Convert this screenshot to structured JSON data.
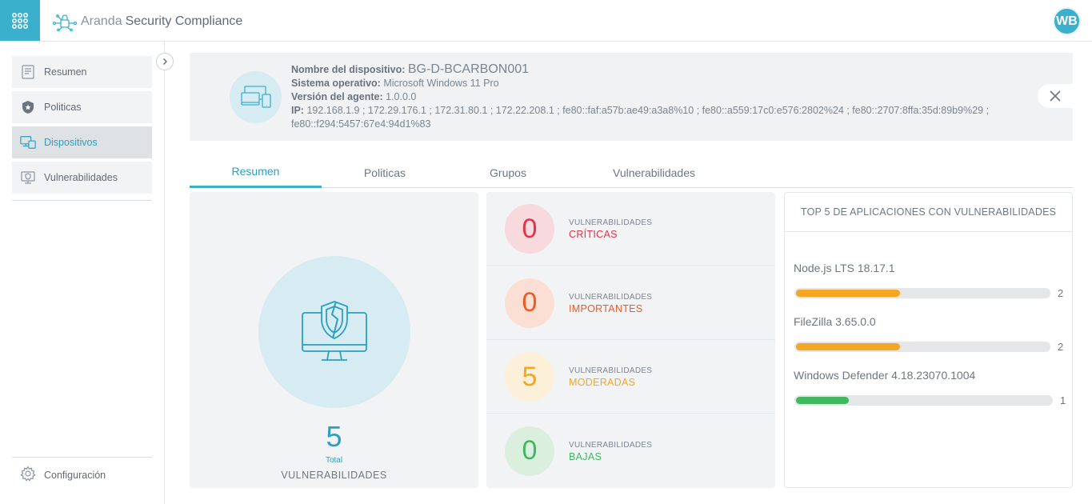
{
  "header": {
    "brand_aranda": "Aranda",
    "brand_product": "Security Compliance",
    "avatar_initials": "WB"
  },
  "sidebar": {
    "items": [
      {
        "label": "Resumen",
        "icon": "document-icon"
      },
      {
        "label": "Politicas",
        "icon": "shield-star-icon"
      },
      {
        "label": "Dispositivos",
        "icon": "devices-icon",
        "active": true
      },
      {
        "label": "Vulnerabilidades",
        "icon": "monitor-shield-icon"
      }
    ],
    "config_label": "Configuración"
  },
  "device": {
    "name_label": "Nombre del dispositivo:",
    "name_value": "BG-D-BCARBON001",
    "os_label": "Sistema operativo:",
    "os_value": "Microsoft Windows 11 Pro",
    "agent_label": "Versión del agente:",
    "agent_value": "1.0.0.0",
    "ip_label": "IP:",
    "ip_value": "192.168.1.9 ; 172.29.176.1 ; 172.31.80.1 ; 172.22.208.1 ; fe80::faf:a57b:ae49:a3a8%10 ; fe80::a559:17c0:e576:2802%24 ; fe80::2707:8ffa:35d:89b9%29 ; fe80::f294:5457:67e4:94d1%83"
  },
  "tabs": [
    {
      "label": "Resumen",
      "active": true
    },
    {
      "label": "Politicas"
    },
    {
      "label": "Grupos"
    },
    {
      "label": "Vulnerabilidades"
    }
  ],
  "summary": {
    "total_number": "5",
    "total_label": "Total",
    "vuln_label": "VULNERABILIDADES"
  },
  "severity": [
    {
      "count": "0",
      "small": "VULNERABILIDADES",
      "level": "CRÍTICAS",
      "color": "#e0344b",
      "bg": "#f8d9dd"
    },
    {
      "count": "0",
      "small": "VULNERABILIDADES",
      "level": "IMPORTANTES",
      "color": "#ee5a24",
      "bg": "#fbdfd4"
    },
    {
      "count": "5",
      "small": "VULNERABILIDADES",
      "level": "MODERADAS",
      "color": "#f5a623",
      "bg": "#fdf0d8"
    },
    {
      "count": "0",
      "small": "VULNERABILIDADES",
      "level": "BAJAS",
      "color": "#3fb85f",
      "bg": "#dbefdf"
    }
  ],
  "top5": {
    "title": "TOP 5 DE APLICACIONES CON VULNERABILIDADES",
    "apps": [
      {
        "name": "Node.js LTS 18.17.1",
        "count": "2",
        "fraction": 0.41,
        "color": "#f5a623"
      },
      {
        "name": "FileZilla 3.65.0.0",
        "count": "2",
        "fraction": 0.41,
        "color": "#f5a623"
      },
      {
        "name": "Windows Defender 4.18.23070.1004",
        "count": "1",
        "fraction": 0.21,
        "color": "#3fb85f"
      }
    ]
  },
  "colors": {
    "accent": "#3ab0cd",
    "accent_text": "#2b9fc2"
  }
}
